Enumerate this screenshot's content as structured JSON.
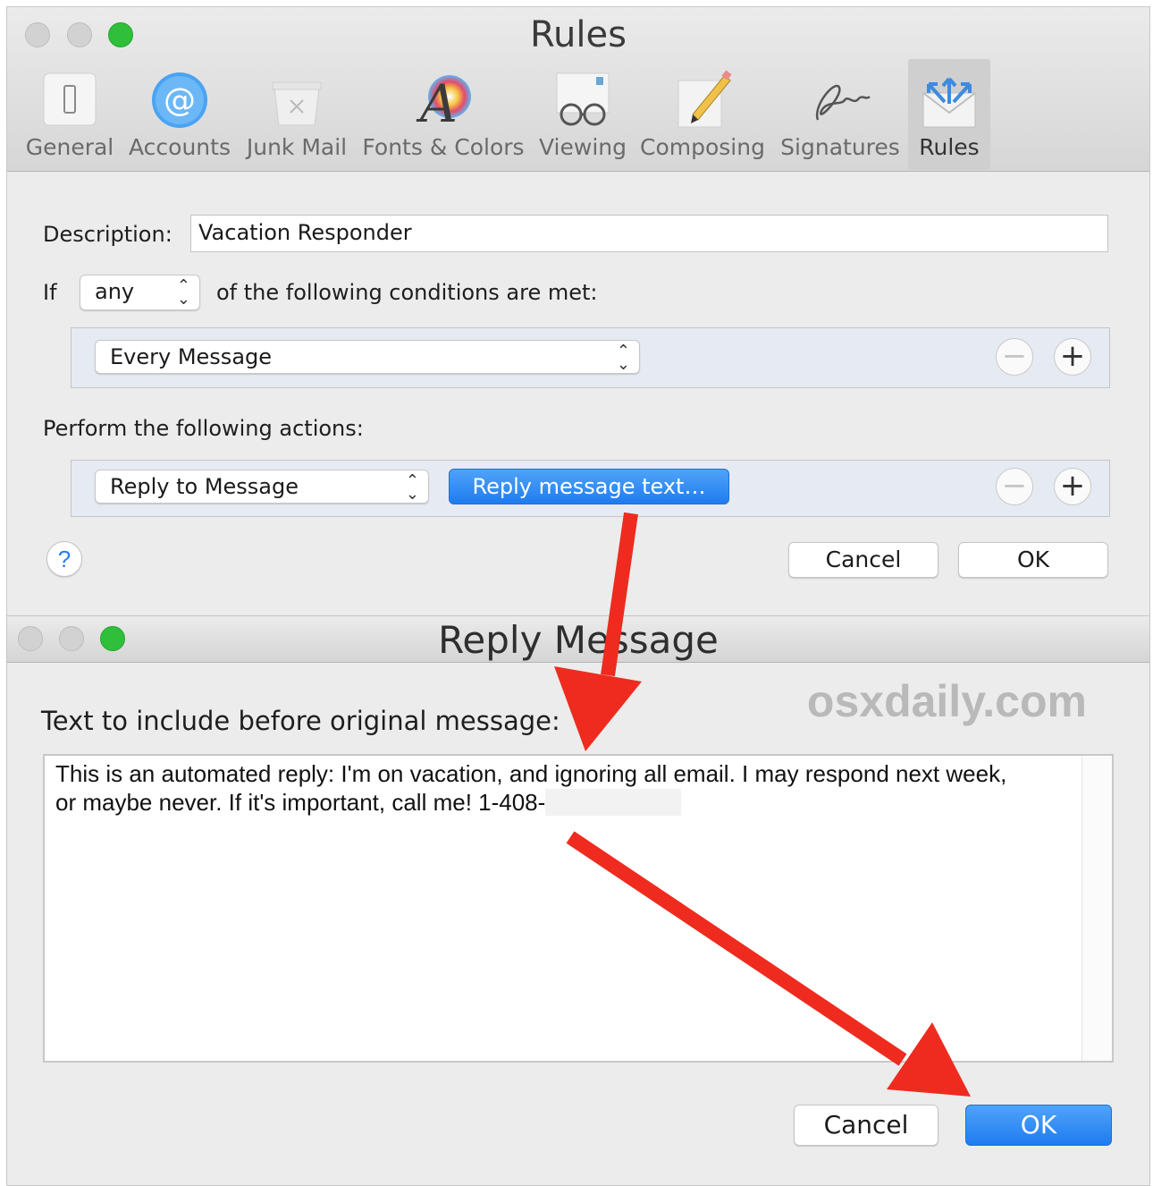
{
  "rules_window": {
    "title": "Rules",
    "toolbar": [
      {
        "label": "General",
        "icon": "general-icon"
      },
      {
        "label": "Accounts",
        "icon": "accounts-icon"
      },
      {
        "label": "Junk Mail",
        "icon": "junk-mail-icon"
      },
      {
        "label": "Fonts & Colors",
        "icon": "fonts-colors-icon"
      },
      {
        "label": "Viewing",
        "icon": "viewing-icon"
      },
      {
        "label": "Composing",
        "icon": "composing-icon"
      },
      {
        "label": "Signatures",
        "icon": "signatures-icon"
      },
      {
        "label": "Rules",
        "icon": "rules-icon",
        "selected": true
      }
    ],
    "description_label": "Description:",
    "description_value": "Vacation Responder",
    "if_label": "If",
    "match_select": "any",
    "conditions_label": "of the following conditions are met:",
    "condition_select": "Every Message",
    "actions_label": "Perform the following actions:",
    "action_select": "Reply to Message",
    "reply_text_button": "Reply message text…",
    "help_label": "?",
    "cancel_label": "Cancel",
    "ok_label": "OK",
    "remove_label": "−",
    "add_label": "+"
  },
  "reply_window": {
    "title": "Reply Message",
    "watermark": "osxdaily.com",
    "prompt_label": "Text to include before original message:",
    "message_line1": "This is an automated reply: I'm on vacation, and ignoring all email. I may respond next week,",
    "message_line2": "or maybe never. If it's important, call me! 1-408-",
    "cancel_label": "Cancel",
    "ok_label": "OK"
  },
  "colors": {
    "accent_blue": "#1f7cf0",
    "annotation_red": "#ef2b1f",
    "traffic_green": "#2fbf3a"
  }
}
